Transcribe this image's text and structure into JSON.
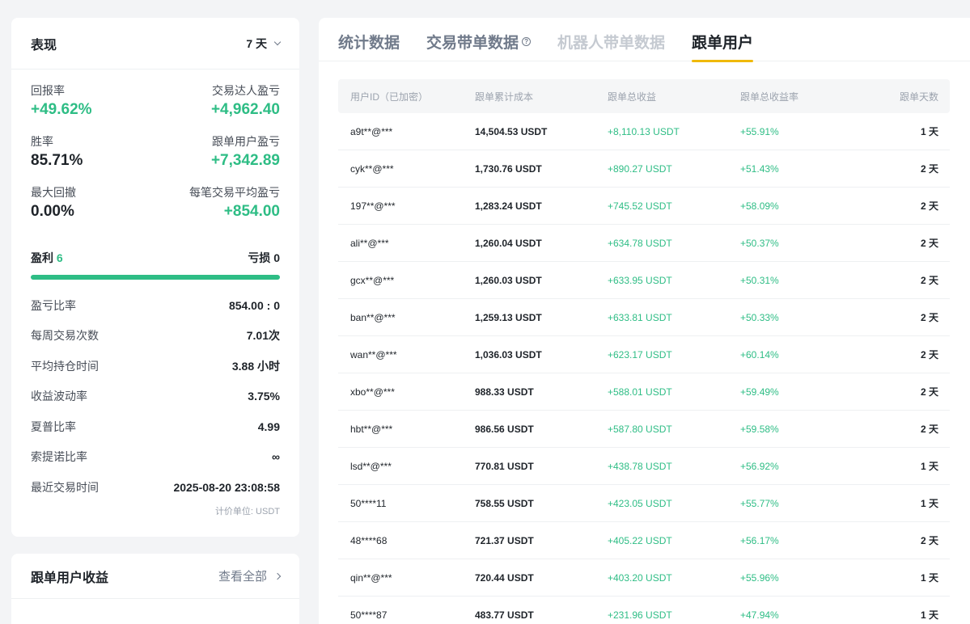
{
  "performance": {
    "title": "表现",
    "period": "7 天",
    "metrics": [
      {
        "left_label": "回报率",
        "left_value": "+49.62%",
        "right_label": "交易达人盈亏",
        "right_value": "+4,962.40"
      },
      {
        "left_label": "胜率",
        "left_value": "85.71%",
        "right_label": "跟单用户盈亏",
        "right_value": "+7,342.89"
      },
      {
        "left_label": "最大回撤",
        "left_value": "0.00%",
        "right_label": "每笔交易平均盈亏",
        "right_value": "+854.00"
      }
    ],
    "profit_label": "盈利",
    "profit_count": "6",
    "loss_label": "亏损",
    "loss_count": "0",
    "win_ratio": 1.0,
    "stats": [
      {
        "label": "盈亏比率",
        "value": "854.00 : 0"
      },
      {
        "label": "每周交易次数",
        "value": "7.01次"
      },
      {
        "label": "平均持仓时间",
        "value": "3.88 小时"
      },
      {
        "label": "收益波动率",
        "value": "3.75%"
      },
      {
        "label": "夏普比率",
        "value": "4.99"
      },
      {
        "label": "索提诺比率",
        "value": "∞"
      },
      {
        "label": "最近交易时间",
        "value": "2025-08-20 23:08:58"
      }
    ],
    "unit_note": "计价单位: USDT"
  },
  "copy_earnings": {
    "title": "跟单用户收益",
    "see_all": "查看全部"
  },
  "tabs": [
    {
      "label": "统计数据",
      "state": "normal"
    },
    {
      "label": "交易带单数据",
      "state": "normal",
      "info_icon": true
    },
    {
      "label": "机器人带单数据",
      "state": "disabled"
    },
    {
      "label": "跟单用户",
      "state": "active"
    }
  ],
  "table": {
    "headers": [
      "用户ID（已加密）",
      "跟单累计成本",
      "跟单总收益",
      "跟单总收益率",
      "跟单天数"
    ],
    "rows": [
      [
        "a9t**@***",
        "14,504.53 USDT",
        "+8,110.13 USDT",
        "+55.91%",
        "1 天"
      ],
      [
        "cyk**@***",
        "1,730.76 USDT",
        "+890.27 USDT",
        "+51.43%",
        "2 天"
      ],
      [
        "197**@***",
        "1,283.24 USDT",
        "+745.52 USDT",
        "+58.09%",
        "2 天"
      ],
      [
        "ali**@***",
        "1,260.04 USDT",
        "+634.78 USDT",
        "+50.37%",
        "2 天"
      ],
      [
        "gcx**@***",
        "1,260.03 USDT",
        "+633.95 USDT",
        "+50.31%",
        "2 天"
      ],
      [
        "ban**@***",
        "1,259.13 USDT",
        "+633.81 USDT",
        "+50.33%",
        "2 天"
      ],
      [
        "wan**@***",
        "1,036.03 USDT",
        "+623.17 USDT",
        "+60.14%",
        "2 天"
      ],
      [
        "xbo**@***",
        "988.33 USDT",
        "+588.01 USDT",
        "+59.49%",
        "2 天"
      ],
      [
        "hbt**@***",
        "986.56 USDT",
        "+587.80 USDT",
        "+59.58%",
        "2 天"
      ],
      [
        "lsd**@***",
        "770.81 USDT",
        "+438.78 USDT",
        "+56.92%",
        "1 天"
      ],
      [
        "50****11",
        "758.55 USDT",
        "+423.05 USDT",
        "+55.77%",
        "1 天"
      ],
      [
        "48****68",
        "721.37 USDT",
        "+405.22 USDT",
        "+56.17%",
        "2 天"
      ],
      [
        "qin**@***",
        "720.44 USDT",
        "+403.20 USDT",
        "+55.96%",
        "1 天"
      ],
      [
        "50****87",
        "483.77 USDT",
        "+231.96 USDT",
        "+47.94%",
        "1 天"
      ]
    ]
  }
}
